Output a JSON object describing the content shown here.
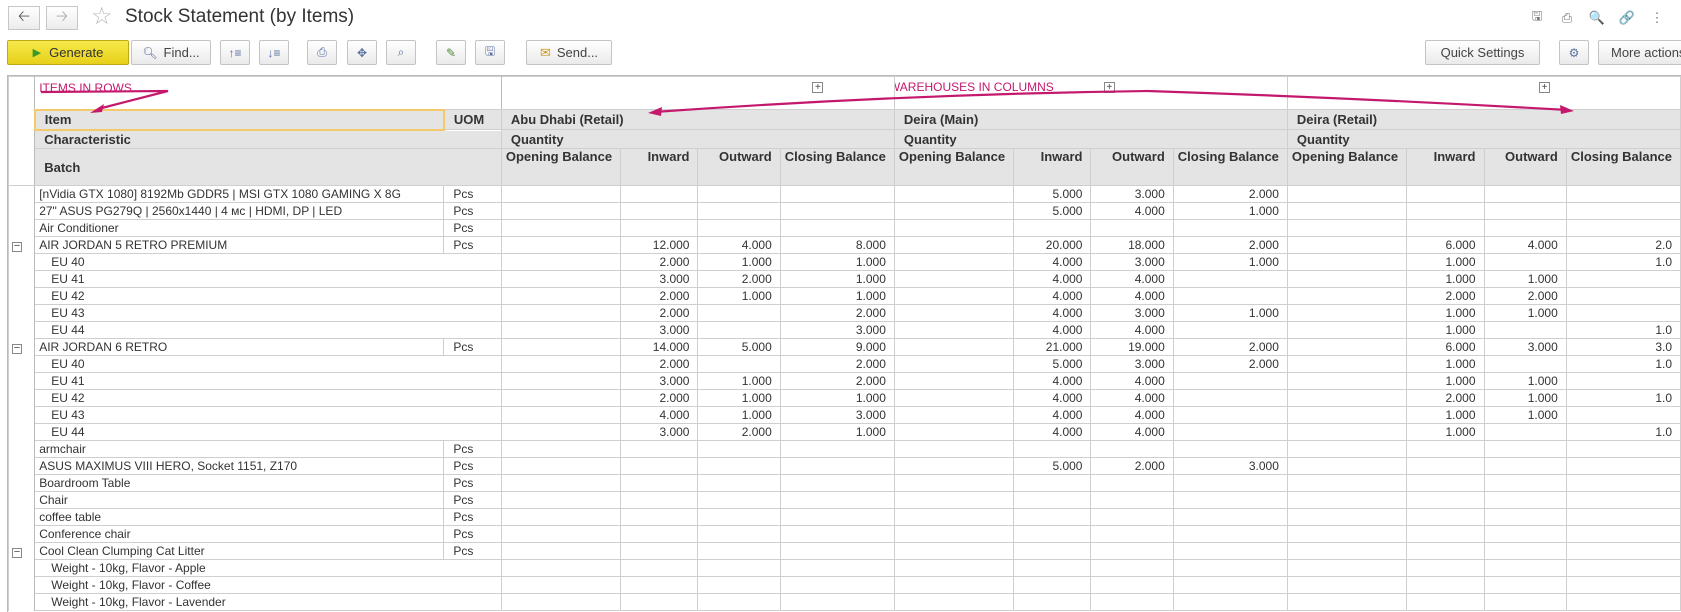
{
  "window": {
    "title": "Stock Statement (by Items)"
  },
  "toolbar": {
    "generate": "Generate",
    "find": "Find...",
    "send": "Send...",
    "quick_settings": "Quick Settings",
    "more_actions": "More actions"
  },
  "annotations": {
    "items_in_rows": "ITEMS IN ROWS",
    "warehouses_in_columns": "WAREHOUSES IN COLUMNS"
  },
  "headers": {
    "item": "Item",
    "uom": "UOM",
    "characteristic": "Characteristic",
    "batch": "Batch",
    "quantity": "Quantity",
    "opening": "Opening Balance",
    "inward": "Inward",
    "outward": "Outward",
    "closing": "Closing Balance"
  },
  "warehouses": [
    "Abu Dhabi (Retail)",
    "Deira (Main)",
    "Deira (Retail)"
  ],
  "colors": {
    "accent": "#c4186d",
    "generate_bg": "#f0dc2c"
  },
  "icons": [
    "back-arrow-icon",
    "forward-arrow-icon",
    "star-icon",
    "save-icon",
    "print-icon",
    "preview-icon",
    "link-icon",
    "more-vertical-icon"
  ],
  "rows": [
    {
      "tree": "",
      "item": "[nVidia GTX 1080] 8192Mb GDDR5 | MSI GTX 1080 GAMING X 8G",
      "uom": "Pcs",
      "sub": false,
      "v": [
        "",
        "",
        "",
        "",
        "",
        "5.000",
        "3.000",
        "2.000",
        "",
        "",
        "",
        ""
      ]
    },
    {
      "tree": "",
      "item": "27\" ASUS PG279Q | 2560x1440 | 4 мс | HDMI, DP | LED",
      "uom": "Pcs",
      "sub": false,
      "v": [
        "",
        "",
        "",
        "",
        "",
        "5.000",
        "4.000",
        "1.000",
        "",
        "",
        "",
        ""
      ]
    },
    {
      "tree": "",
      "item": "Air Conditioner",
      "uom": "Pcs",
      "sub": false,
      "v": [
        "",
        "",
        "",
        "",
        "",
        "",
        "",
        "",
        "",
        "",
        "",
        ""
      ]
    },
    {
      "tree": "−",
      "item": "AIR JORDAN 5 RETRO PREMIUM",
      "uom": "Pcs",
      "sub": false,
      "v": [
        "",
        "12.000",
        "4.000",
        "8.000",
        "",
        "20.000",
        "18.000",
        "2.000",
        "",
        "6.000",
        "4.000",
        "2.0"
      ]
    },
    {
      "tree": "",
      "item": "EU 40",
      "uom": "",
      "sub": true,
      "v": [
        "",
        "2.000",
        "1.000",
        "1.000",
        "",
        "4.000",
        "3.000",
        "1.000",
        "",
        "1.000",
        "",
        "1.0"
      ]
    },
    {
      "tree": "",
      "item": "EU 41",
      "uom": "",
      "sub": true,
      "v": [
        "",
        "3.000",
        "2.000",
        "1.000",
        "",
        "4.000",
        "4.000",
        "",
        "",
        "1.000",
        "1.000",
        ""
      ]
    },
    {
      "tree": "",
      "item": "EU 42",
      "uom": "",
      "sub": true,
      "v": [
        "",
        "2.000",
        "1.000",
        "1.000",
        "",
        "4.000",
        "4.000",
        "",
        "",
        "2.000",
        "2.000",
        ""
      ]
    },
    {
      "tree": "",
      "item": "EU 43",
      "uom": "",
      "sub": true,
      "v": [
        "",
        "2.000",
        "",
        "2.000",
        "",
        "4.000",
        "3.000",
        "1.000",
        "",
        "1.000",
        "1.000",
        ""
      ]
    },
    {
      "tree": "",
      "item": "EU 44",
      "uom": "",
      "sub": true,
      "v": [
        "",
        "3.000",
        "",
        "3.000",
        "",
        "4.000",
        "4.000",
        "",
        "",
        "1.000",
        "",
        "1.0"
      ]
    },
    {
      "tree": "−",
      "item": "AIR JORDAN 6 RETRO",
      "uom": "Pcs",
      "sub": false,
      "v": [
        "",
        "14.000",
        "5.000",
        "9.000",
        "",
        "21.000",
        "19.000",
        "2.000",
        "",
        "6.000",
        "3.000",
        "3.0"
      ]
    },
    {
      "tree": "",
      "item": "EU 40",
      "uom": "",
      "sub": true,
      "v": [
        "",
        "2.000",
        "",
        "2.000",
        "",
        "5.000",
        "3.000",
        "2.000",
        "",
        "1.000",
        "",
        "1.0"
      ]
    },
    {
      "tree": "",
      "item": "EU 41",
      "uom": "",
      "sub": true,
      "v": [
        "",
        "3.000",
        "1.000",
        "2.000",
        "",
        "4.000",
        "4.000",
        "",
        "",
        "1.000",
        "1.000",
        ""
      ]
    },
    {
      "tree": "",
      "item": "EU 42",
      "uom": "",
      "sub": true,
      "v": [
        "",
        "2.000",
        "1.000",
        "1.000",
        "",
        "4.000",
        "4.000",
        "",
        "",
        "2.000",
        "1.000",
        "1.0"
      ]
    },
    {
      "tree": "",
      "item": "EU 43",
      "uom": "",
      "sub": true,
      "v": [
        "",
        "4.000",
        "1.000",
        "3.000",
        "",
        "4.000",
        "4.000",
        "",
        "",
        "1.000",
        "1.000",
        ""
      ]
    },
    {
      "tree": "",
      "item": "EU 44",
      "uom": "",
      "sub": true,
      "v": [
        "",
        "3.000",
        "2.000",
        "1.000",
        "",
        "4.000",
        "4.000",
        "",
        "",
        "1.000",
        "",
        "1.0"
      ]
    },
    {
      "tree": "",
      "item": "armchair",
      "uom": "Pcs",
      "sub": false,
      "v": [
        "",
        "",
        "",
        "",
        "",
        "",
        "",
        "",
        "",
        "",
        "",
        ""
      ]
    },
    {
      "tree": "",
      "item": "ASUS MAXIMUS VIII HERO, Socket 1151, Z170",
      "uom": "Pcs",
      "sub": false,
      "v": [
        "",
        "",
        "",
        "",
        "",
        "5.000",
        "2.000",
        "3.000",
        "",
        "",
        "",
        ""
      ]
    },
    {
      "tree": "",
      "item": "Boardroom Table",
      "uom": "Pcs",
      "sub": false,
      "v": [
        "",
        "",
        "",
        "",
        "",
        "",
        "",
        "",
        "",
        "",
        "",
        ""
      ]
    },
    {
      "tree": "",
      "item": "Chair",
      "uom": "Pcs",
      "sub": false,
      "v": [
        "",
        "",
        "",
        "",
        "",
        "",
        "",
        "",
        "",
        "",
        "",
        ""
      ]
    },
    {
      "tree": "",
      "item": "coffee table",
      "uom": "Pcs",
      "sub": false,
      "v": [
        "",
        "",
        "",
        "",
        "",
        "",
        "",
        "",
        "",
        "",
        "",
        ""
      ]
    },
    {
      "tree": "",
      "item": "Conference chair",
      "uom": "Pcs",
      "sub": false,
      "v": [
        "",
        "",
        "",
        "",
        "",
        "",
        "",
        "",
        "",
        "",
        "",
        ""
      ]
    },
    {
      "tree": "−",
      "item": "Cool Clean Clumping Cat Litter",
      "uom": "Pcs",
      "sub": false,
      "v": [
        "",
        "",
        "",
        "",
        "",
        "",
        "",
        "",
        "",
        "",
        "",
        ""
      ]
    },
    {
      "tree": "",
      "item": "Weight - 10kg, Flavor - Apple",
      "uom": "",
      "sub": true,
      "v": [
        "",
        "",
        "",
        "",
        "",
        "",
        "",
        "",
        "",
        "",
        "",
        ""
      ]
    },
    {
      "tree": "",
      "item": "Weight - 10kg, Flavor - Coffee",
      "uom": "",
      "sub": true,
      "v": [
        "",
        "",
        "",
        "",
        "",
        "",
        "",
        "",
        "",
        "",
        "",
        ""
      ]
    },
    {
      "tree": "",
      "item": "Weight - 10kg, Flavor - Lavender",
      "uom": "",
      "sub": true,
      "v": [
        "",
        "",
        "",
        "",
        "",
        "",
        "",
        "",
        "",
        "",
        "",
        ""
      ]
    }
  ]
}
